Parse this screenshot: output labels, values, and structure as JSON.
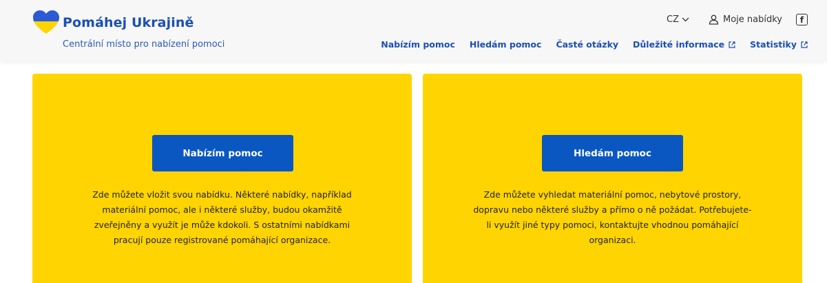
{
  "brand": {
    "name": "Pomáhej Ukrajině",
    "tagline": "Centrální místo pro nabízení pomoci",
    "colors": {
      "blue": "#2a5bd7",
      "yellow": "#ffd400"
    }
  },
  "utility": {
    "language": "CZ",
    "account_label": "Moje nabídky",
    "social_icon": "facebook-icon"
  },
  "nav": {
    "items": [
      {
        "label": "Nabízím pomoc"
      },
      {
        "label": "Hledám pomoc"
      },
      {
        "label": "Časté otázky"
      },
      {
        "label": "Důležité informace"
      },
      {
        "label": "Statistiky"
      }
    ]
  },
  "cards": {
    "offer": {
      "button": "Nabízím pomoc",
      "text": "Zde můžete vložit svou nabídku. Některé nabídky, například materiální pomoc, ale i některé služby, budou okamžitě zveřejněny a využít je může kdokoli. S ostatními nabídkami pracují pouze registrované pomáhající organizace."
    },
    "seek": {
      "button": "Hledám pomoc",
      "text": "Zde můžete vyhledat materiální pomoc, nebytové prostory, dopravu nebo některé služby a přímo o ně požádat. Potřebujete-li využít jiné typy pomoci, kontaktujte vhodnou pomáhající organizaci."
    }
  },
  "theme": {
    "accent": "#0a57c1",
    "card_bg": "#ffd400",
    "header_bg": "#f7f7f7"
  }
}
